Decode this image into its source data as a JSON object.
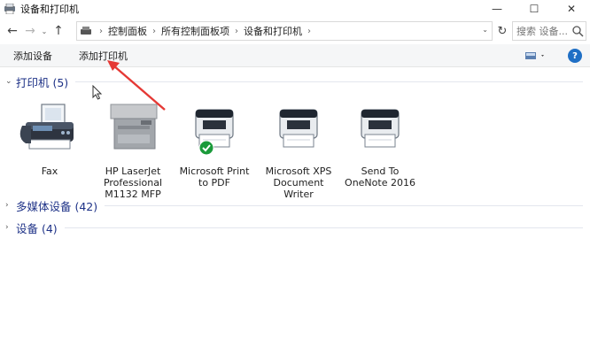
{
  "window": {
    "title": "设备和打印机",
    "controls": {
      "minimize": "—",
      "maximize": "☐",
      "close": "✕"
    }
  },
  "nav": {
    "back": "←",
    "forward": "→",
    "recent": "⌄",
    "up": "↑",
    "breadcrumb": [
      "控制面板",
      "所有控制面板项",
      "设备和打印机"
    ],
    "refresh": "↻",
    "search_placeholder": "搜索 设备..."
  },
  "commands": {
    "add_device": "添加设备",
    "add_printer": "添加打印机",
    "help": "?"
  },
  "groups": {
    "printers": "打印机 (5)",
    "multimedia": "多媒体设备 (42)",
    "devices": "设备 (4)"
  },
  "devices": [
    {
      "label_lines": [
        "Fax"
      ]
    },
    {
      "label_lines": [
        "HP LaserJet",
        "Professional",
        "M1132 MFP"
      ]
    },
    {
      "label_lines": [
        "Microsoft Print",
        "to PDF"
      ],
      "default": true
    },
    {
      "label_lines": [
        "Microsoft XPS",
        "Document",
        "Writer"
      ]
    },
    {
      "label_lines": [
        "Send To",
        "OneNote 2016"
      ]
    }
  ],
  "colors": {
    "group_title": "#1e3287",
    "annotation_arrow": "#e53935",
    "default_check": "#1a9a3a",
    "help_icon": "#1f6fc5"
  }
}
